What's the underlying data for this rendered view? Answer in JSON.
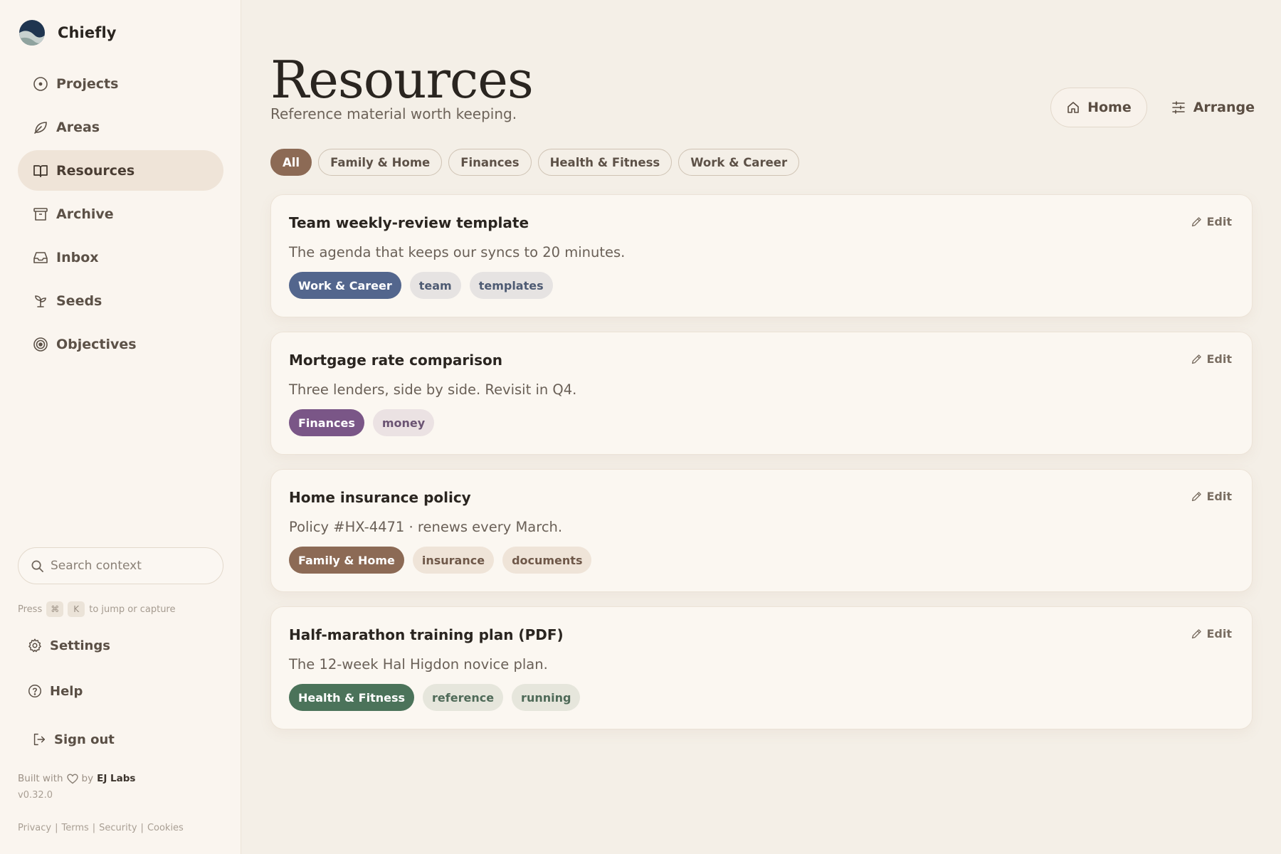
{
  "app": {
    "name": "Chiefly"
  },
  "sidebar": {
    "items": [
      {
        "label": "Projects",
        "icon": "circle-dot-icon",
        "active": false
      },
      {
        "label": "Areas",
        "icon": "leaf-icon",
        "active": false
      },
      {
        "label": "Resources",
        "icon": "book-open-icon",
        "active": true
      },
      {
        "label": "Archive",
        "icon": "archive-box-icon",
        "active": false
      },
      {
        "label": "Inbox",
        "icon": "inbox-tray-icon",
        "active": false
      },
      {
        "label": "Seeds",
        "icon": "sprout-icon",
        "active": false
      },
      {
        "label": "Objectives",
        "icon": "target-icon",
        "active": false
      }
    ],
    "search": {
      "placeholder": "Search context"
    },
    "hint": {
      "press": "Press",
      "key1": "⌘",
      "key2": "K",
      "rest": "to jump or capture"
    },
    "settings_label": "Settings",
    "help_label": "Help",
    "signout_label": "Sign out",
    "built": {
      "prefix": "Built with",
      "by": "by",
      "company": "EJ Labs"
    },
    "version": "v0.32.0",
    "legal": {
      "privacy": "Privacy",
      "terms": "Terms",
      "security": "Security",
      "cookies": "Cookies",
      "sep": "|"
    }
  },
  "page": {
    "title": "Resources",
    "subtitle": "Reference material worth keeping.",
    "home_label": "Home",
    "arrange_label": "Arrange",
    "filters": [
      "All",
      "Family & Home",
      "Finances",
      "Health & Fitness",
      "Work & Career"
    ],
    "active_filter": "All",
    "edit_label": "Edit"
  },
  "cards": [
    {
      "title": "Team weekly-review template",
      "desc": "The agenda that keeps our syncs to 20 minutes.",
      "tags": [
        {
          "label": "Work & Career",
          "primary": true,
          "bg": "#53668d",
          "fg": "#ffffff"
        },
        {
          "label": "team",
          "primary": false,
          "bg": "#e6e3e2",
          "fg": "#4e5b73"
        },
        {
          "label": "templates",
          "primary": false,
          "bg": "#e6e3e2",
          "fg": "#4e5b73"
        }
      ]
    },
    {
      "title": "Mortgage rate comparison",
      "desc": "Three lenders, side by side. Revisit in Q4.",
      "tags": [
        {
          "label": "Finances",
          "primary": true,
          "bg": "#7a5687",
          "fg": "#ffffff"
        },
        {
          "label": "money",
          "primary": false,
          "bg": "#ebe2e3",
          "fg": "#6b5473"
        }
      ]
    },
    {
      "title": "Home insurance policy",
      "desc": "Policy #HX-4471 · renews every March.",
      "tags": [
        {
          "label": "Family & Home",
          "primary": true,
          "bg": "#8c6a55",
          "fg": "#ffffff"
        },
        {
          "label": "insurance",
          "primary": false,
          "bg": "#efe4d8",
          "fg": "#6f5849"
        },
        {
          "label": "documents",
          "primary": false,
          "bg": "#efe4d8",
          "fg": "#6f5849"
        }
      ]
    },
    {
      "title": "Half-marathon training plan (PDF)",
      "desc": "The 12-week Hal Higdon novice plan.",
      "tags": [
        {
          "label": "Health & Fitness",
          "primary": true,
          "bg": "#4b735a",
          "fg": "#ffffff"
        },
        {
          "label": "reference",
          "primary": false,
          "bg": "#e6e6dc",
          "fg": "#4f6a58"
        },
        {
          "label": "running",
          "primary": false,
          "bg": "#e6e6dc",
          "fg": "#4f6a58"
        }
      ]
    }
  ],
  "colors": {
    "accent": "#8c6a55",
    "background": "#f4efe7",
    "sidebar": "#faf5ef"
  }
}
